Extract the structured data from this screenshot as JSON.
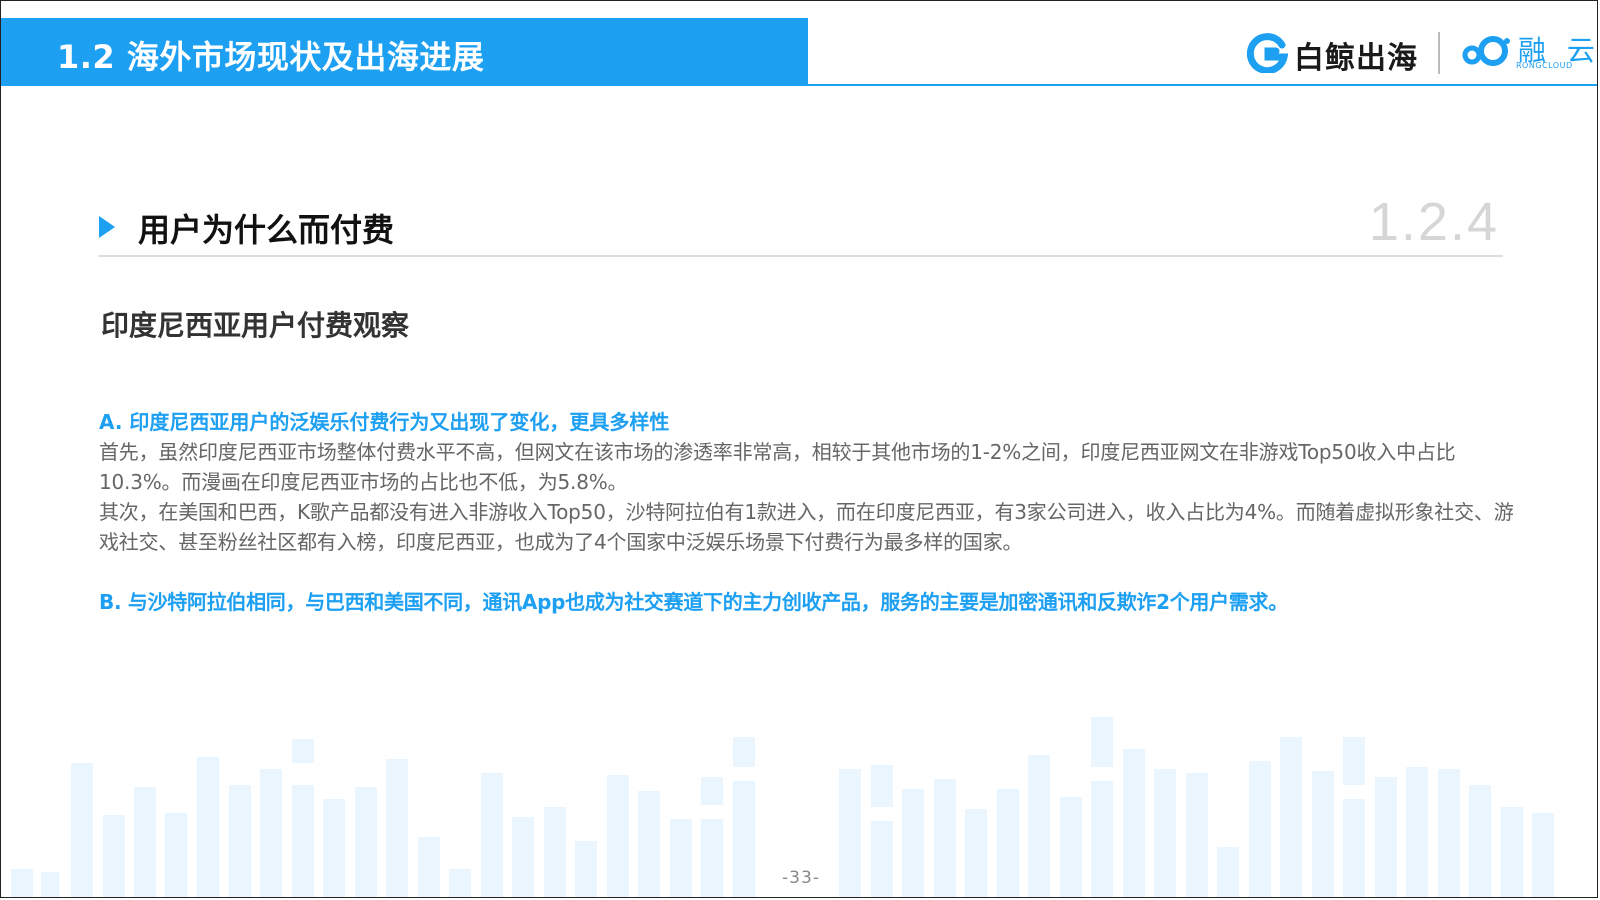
{
  "header": {
    "title": "1.2 海外市场现状及出海进展",
    "logo_left": "白鲸出海",
    "logo_right": "融 云",
    "logo_right_sub": "RONGCLOUD",
    "accent_color": "#1d9ff2"
  },
  "section": {
    "title": "用户为什么而付费",
    "number": "1.2.4"
  },
  "subtitle": "印度尼西亚用户付费观察",
  "content": {
    "heading_a": "A. 印度尼西亚用户的泛娱乐付费行为又出现了变化，更具多样性",
    "para_1": "首先，虽然印度尼西亚市场整体付费水平不高，但网文在该市场的渗透率非常高，相较于其他市场的1-2%之间，印度尼西亚网文在非游戏Top50收入中占比10.3%。而漫画在印度尼西亚市场的占比也不低，为5.8%。",
    "para_2": "其次，在美国和巴西，K歌产品都没有进入非游收入Top50，沙特阿拉伯有1款进入，而在印度尼西亚，有3家公司进入，收入占比为4%。而随着虚拟形象社交、游戏社交、甚至粉丝社区都有入榜，印度尼西亚，也成为了4个国家中泛娱乐场景下付费行为最多样的国家。",
    "heading_b": "B. 与沙特阿拉伯相同，与巴西和美国不同，通讯App也成为社交赛道下的主力创收产品，服务的主要是加密通讯和反欺诈2个用户需求。"
  },
  "footer": {
    "page_number": "-33-"
  }
}
